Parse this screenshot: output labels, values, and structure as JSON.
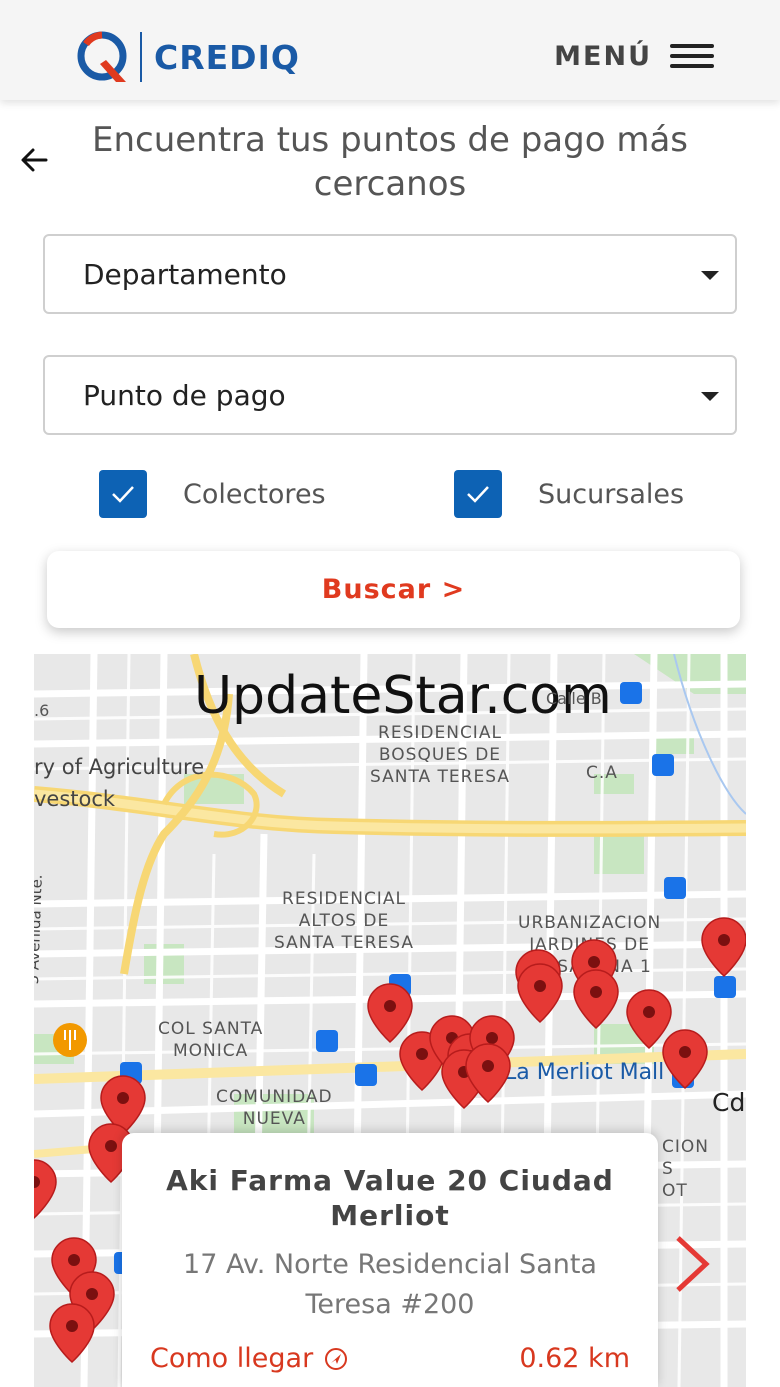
{
  "header": {
    "brand": "CREDIQ",
    "menu_label": "MENÚ"
  },
  "page": {
    "title": "Encuentra tus puntos de pago más cercanos"
  },
  "filters": {
    "departamento": "Departamento",
    "punto_pago": "Punto de pago",
    "checkboxes": [
      {
        "label": "Colectores",
        "checked": true
      },
      {
        "label": "Sucursales",
        "checked": true
      }
    ],
    "search_label": "Buscar >"
  },
  "map": {
    "watermark": "UpdateStar.com",
    "labels": {
      "res_bosques": "RESIDENCIAL\nBOSQUES DE\nSANTA TERESA",
      "agri1": "ry of Agriculture",
      "agri2": "vestock",
      "res_altos": "RESIDENCIAL\nALTOS DE\nSANTA TERESA",
      "urbanizacion": "URBANIZACION\nJARDINES DE\nLA SABANA 1",
      "col_santa": "COL SANTA\nMONICA",
      "comunidad": "COMUNIDAD\nNUEVA",
      "avenida": "5 Avenida Nte.",
      "calle_b": "Calle B",
      "ca": "C.A",
      "merliot": "La Merliot Mall",
      "cd": "Cd",
      "six": ".6",
      "cion": "CION\nS\nOT"
    }
  },
  "card": {
    "name": "Aki Farma Value 20 Ciudad Merliot",
    "address": "17 Av. Norte Residencial Santa Teresa #200",
    "directions_label": "Como llegar",
    "distance": "0.62 km"
  },
  "colors": {
    "accent": "#e03a1f",
    "brand": "#1a5aa6",
    "checkbox": "#0d62b4",
    "pin": "#e53935"
  }
}
